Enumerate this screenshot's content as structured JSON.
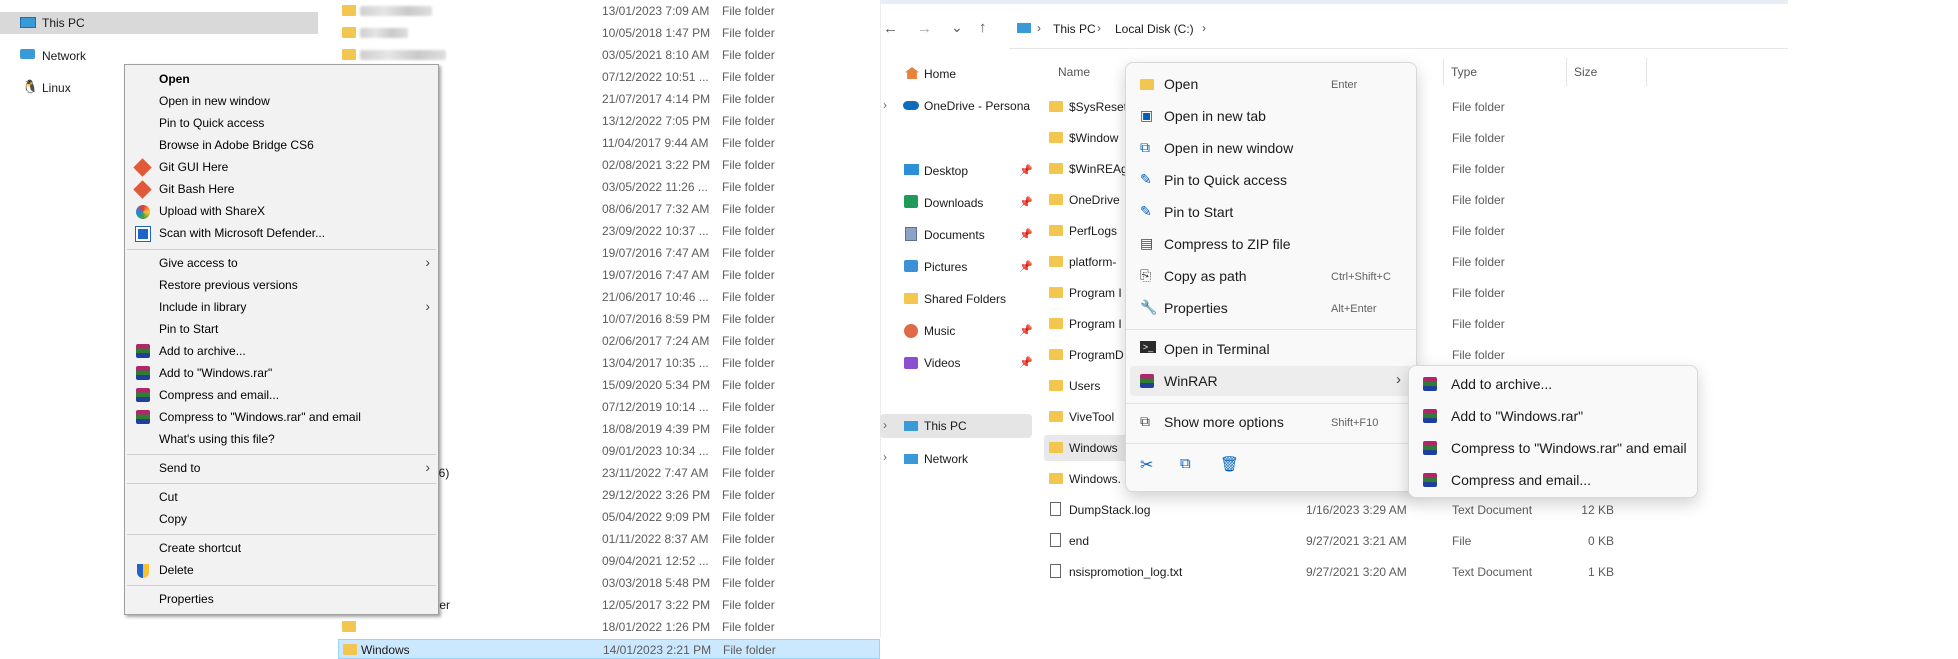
{
  "left": {
    "sidebar": [
      {
        "label": "This PC",
        "icon": "computer-icon"
      },
      {
        "label": "Network",
        "icon": "network-icon"
      },
      {
        "label": "Linux",
        "icon": "linux-icon"
      }
    ],
    "rows": [
      {
        "name": "",
        "date": "13/01/2023 7:09 AM",
        "type": "File folder"
      },
      {
        "name": "",
        "date": "10/05/2018 1:47 PM",
        "type": "File folder"
      },
      {
        "name": "",
        "date": "03/05/2021 8:10 AM",
        "type": "File folder"
      },
      {
        "name": "",
        "date": "07/12/2022 10:51 ...",
        "type": "File folder"
      },
      {
        "name": "",
        "date": "21/07/2017 4:14 PM",
        "type": "File folder"
      },
      {
        "name": "",
        "date": "13/12/2022 7:05 PM",
        "type": "File folder"
      },
      {
        "name": "",
        "date": "11/04/2017 9:44 AM",
        "type": "File folder"
      },
      {
        "name": "",
        "date": "02/08/2021 3:22 PM",
        "type": "File folder"
      },
      {
        "name": "",
        "date": "03/05/2022 11:26 ...",
        "type": "File folder"
      },
      {
        "name": "",
        "date": "08/06/2017 7:32 AM",
        "type": "File folder"
      },
      {
        "name": "",
        "date": "23/09/2022 10:37 ...",
        "type": "File folder"
      },
      {
        "name": "",
        "date": "19/07/2016 7:47 AM",
        "type": "File folder"
      },
      {
        "name": "",
        "date": "19/07/2016 7:47 AM",
        "type": "File folder"
      },
      {
        "name": "",
        "date": "21/06/2017 10:46 ...",
        "type": "File folder"
      },
      {
        "name": "",
        "date": "10/07/2016 8:59 PM",
        "type": "File folder"
      },
      {
        "name": "",
        "date": "02/06/2017 7:24 AM",
        "type": "File folder"
      },
      {
        "name": "",
        "date": "13/04/2017 10:35 ...",
        "type": "File folder"
      },
      {
        "name": "",
        "date": "15/09/2020 5:34 PM",
        "type": "File folder"
      },
      {
        "name": "",
        "date": "07/12/2019 10:14 ...",
        "type": "File folder"
      },
      {
        "name": "",
        "date": "18/08/2019 4:39 PM",
        "type": "File folder"
      },
      {
        "name": "",
        "date": "09/01/2023 10:34 ...",
        "type": "File folder"
      },
      {
        "name": "x86)",
        "date": "23/11/2022 7:47 AM",
        "type": "File folder"
      },
      {
        "name": "",
        "date": "29/12/2022 3:26 PM",
        "type": "File folder"
      },
      {
        "name": "",
        "date": "05/04/2022 9:09 PM",
        "type": "File folder"
      },
      {
        "name": "",
        "date": "01/11/2022 8:37 AM",
        "type": "File folder"
      },
      {
        "name": "",
        "date": "09/04/2021 12:52 ...",
        "type": "File folder"
      },
      {
        "name": "",
        "date": "03/03/2018 5:48 PM",
        "type": "File folder"
      },
      {
        "name": "nder",
        "date": "12/05/2017 3:22 PM",
        "type": "File folder"
      },
      {
        "name": "",
        "date": "18/01/2022 1:26 PM",
        "type": "File folder"
      },
      {
        "name": "Windows",
        "date": "14/01/2023 2:21 PM",
        "type": "File folder"
      }
    ],
    "context_menu": {
      "open": "Open",
      "open_new_window": "Open in new window",
      "pin_quick": "Pin to Quick access",
      "browse_bridge": "Browse in Adobe Bridge CS6",
      "git_gui": "Git GUI Here",
      "git_bash": "Git Bash Here",
      "sharex": "Upload with ShareX",
      "defender": "Scan with Microsoft Defender...",
      "give_access": "Give access to",
      "restore_prev": "Restore previous versions",
      "include_library": "Include in library",
      "pin_start": "Pin to Start",
      "add_archive": "Add to archive...",
      "add_windows_rar": "Add to \"Windows.rar\"",
      "compress_email": "Compress and email...",
      "compress_rar_email": "Compress to \"Windows.rar\" and email",
      "whats_using": "What's using this file?",
      "send_to": "Send to",
      "cut": "Cut",
      "copy": "Copy",
      "create_shortcut": "Create shortcut",
      "delete": "Delete",
      "properties": "Properties"
    }
  },
  "right": {
    "breadcrumb": [
      "This PC",
      "Local Disk (C:)"
    ],
    "columns": {
      "name": "Name",
      "type": "Type",
      "size": "Size"
    },
    "nav": {
      "home": "Home",
      "onedrive": "OneDrive - Persona",
      "desktop": "Desktop",
      "downloads": "Downloads",
      "documents": "Documents",
      "pictures": "Pictures",
      "shared": "Shared Folders",
      "music": "Music",
      "videos": "Videos",
      "thispc": "This PC",
      "network": "Network"
    },
    "files": [
      {
        "name": "$SysReset",
        "type": "File folder",
        "date": "",
        "size": ""
      },
      {
        "name": "$Window",
        "type": "File folder",
        "date": "",
        "size": ""
      },
      {
        "name": "$WinREAg",
        "type": "File folder",
        "date": "",
        "size": ""
      },
      {
        "name": "OneDrive",
        "type": "File folder",
        "date": "",
        "size": ""
      },
      {
        "name": "PerfLogs",
        "type": "File folder",
        "date": "",
        "size": ""
      },
      {
        "name": "platform-",
        "type": "File folder",
        "date": "",
        "size": ""
      },
      {
        "name": "Program I",
        "type": "File folder",
        "date": "",
        "size": ""
      },
      {
        "name": "Program I",
        "type": "File folder",
        "date": "",
        "size": ""
      },
      {
        "name": "ProgramD",
        "type": "File folder",
        "date": "",
        "size": ""
      },
      {
        "name": "Users",
        "type": "",
        "date": "",
        "size": ""
      },
      {
        "name": "ViveTool",
        "type": "",
        "date": "",
        "size": ""
      },
      {
        "name": "Windows",
        "type": "",
        "date": "",
        "size": ""
      },
      {
        "name": "Windows.",
        "type": "",
        "date": "",
        "size": ""
      },
      {
        "name": "DumpStack.log",
        "type": "Text Document",
        "date": "1/16/2023 3:29 AM",
        "size": "12 KB"
      },
      {
        "name": "end",
        "type": "File",
        "date": "9/27/2021 3:21 AM",
        "size": "0 KB"
      },
      {
        "name": "nsispromotion_log.txt",
        "type": "Text Document",
        "date": "9/27/2021 3:20 AM",
        "size": "1 KB"
      }
    ],
    "context_menu": {
      "open": "Open",
      "open_sc": "Enter",
      "open_tab": "Open in new tab",
      "open_window": "Open in new window",
      "pin_quick": "Pin to Quick access",
      "pin_start": "Pin to Start",
      "zip": "Compress to ZIP file",
      "copy_path": "Copy as path",
      "copy_path_sc": "Ctrl+Shift+C",
      "properties": "Properties",
      "properties_sc": "Alt+Enter",
      "terminal": "Open in Terminal",
      "winrar": "WinRAR",
      "more": "Show more options",
      "more_sc": "Shift+F10"
    },
    "winrar_submenu": {
      "add_archive": "Add to archive...",
      "add_windows_rar": "Add to \"Windows.rar\"",
      "compress_rar_email": "Compress to \"Windows.rar\" and email",
      "compress_email": "Compress and email..."
    }
  },
  "colors": {
    "selection": "#cce8ff",
    "folder": "#f3c652",
    "accent": "#005fb8"
  }
}
